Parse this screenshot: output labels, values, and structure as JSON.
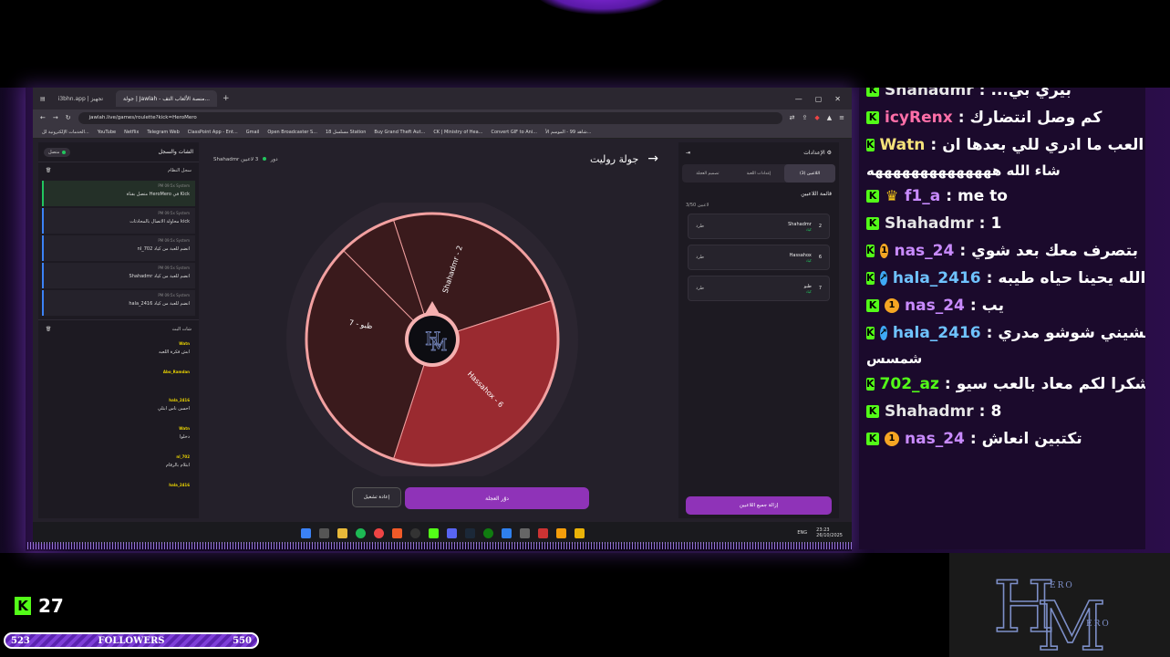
{
  "browser": {
    "tabs": [
      {
        "label": "i3bhn.app | تجهيز"
      },
      {
        "label": "جولة | Jawlah - منصة الألعاب التف..."
      }
    ],
    "new_tab": "+",
    "url": "jawlah.live/games/roulette?kick=HeroMero",
    "bookmarks": [
      "الخدمات الإلكترونية لل...",
      "YouTube",
      "Netflix",
      "Telegram Web",
      "ClassPoint App - Ent...",
      "Gmail",
      "Open Broadcaster S...",
      "مسلسل 18 Station",
      "Buy Grand Theft Aut...",
      "CK | Ministry of Hea...",
      "Convert GIF to Ani...",
      "شاهد 99 - الموسم الأ..."
    ]
  },
  "left_panel": {
    "title": "الشات والسجل",
    "connection_label": "متصل",
    "system_log_label": "سجل النظام",
    "system_items": [
      {
        "meta": "PM 09:5x System",
        "text": "متصل بقناة HeroMero في Kick"
      },
      {
        "meta": "PM 09:5x System",
        "text": "محاولة الاتصال بالمحادثات kick"
      },
      {
        "meta": "PM 09:5x System",
        "text": "nl_702 انضم للعبة من كياد"
      },
      {
        "meta": "PM 09:5x System",
        "text": "Shahadmr انضم للعبة من كياد"
      },
      {
        "meta": "PM 09:5x System",
        "text": "hala_2416 انضم للعبة من كياد"
      }
    ],
    "chat_label": "شات البث",
    "chat_items": [
      {
        "user": "Watn",
        "text": "ابش فكرة اللعبه"
      },
      {
        "user": "Abo_Ramdan",
        "text": ""
      },
      {
        "user": "hala_2416",
        "text": "احسن ناس ابتلي"
      },
      {
        "user": "Watn",
        "text": "دخلوا"
      },
      {
        "user": "nl_702",
        "text": "ابتلام بالرقام"
      },
      {
        "user": "hala_2416",
        "text": ""
      }
    ]
  },
  "center": {
    "host_label": "Shahadmr",
    "host_role": "دور",
    "players_online": "3 لاعبين",
    "title": "جولة روليت",
    "wheel_segments": [
      "Shahadmr - 2",
      "Hassahox - 6",
      "ظبو - 7"
    ],
    "spin_button": "دوّر العجلة",
    "reset_button": "إعادة تشغيل"
  },
  "right_panel": {
    "title": "الإعدادات",
    "tabs": [
      "اللاعبين (3)",
      "إعدادات اللعبة",
      "تصميم العجلة"
    ],
    "list_title": "قائمة اللاعبين",
    "count": "3/50 لاعبين",
    "players": [
      {
        "name": "Shahadmr",
        "role": "كياد",
        "number": "2",
        "kick": "طرد"
      },
      {
        "name": "Hassahox",
        "role": "كياد",
        "number": "6",
        "kick": "طرد"
      },
      {
        "name": "ظبو",
        "role": "كياد",
        "number": "7",
        "kick": "طرد"
      }
    ],
    "remove_all": "إزالة جميع اللاعبين"
  },
  "taskbar": {
    "lang": "ENG",
    "time": "23:23",
    "date": "26/10/2025"
  },
  "stream_chat": {
    "lines": [
      {
        "user": "Shahadmr",
        "msg": "...بيري بي",
        "user_color": "#e6e6e6",
        "badge": ""
      },
      {
        "user": "icyRenx",
        "msg": "كم وصل انتضارك",
        "user_color": "#ff6fa8",
        "badge": ""
      },
      {
        "user": "Watn",
        "msg": "اول مره العب ما ادري للي بعدها ان",
        "user_color": "#f5e27a",
        "badge": ""
      },
      {
        "user": "f1_a",
        "msg": "me to",
        "user_color": "#c98bff",
        "badge": "crown"
      },
      {
        "user": "Shahadmr",
        "msg": "1",
        "user_color": "#e6e6e6",
        "badge": ""
      },
      {
        "user": "nas_24",
        "msg": "بتصرف معك بعد شوي",
        "user_color": "#c98bff",
        "badge": "one"
      },
      {
        "user": "hala_2416",
        "msg": "الله يحينا حياه طيبه",
        "user_color": "#6fc3ff",
        "badge": "arrow"
      },
      {
        "user": "nas_24",
        "msg": "يب",
        "user_color": "#c98bff",
        "badge": "one"
      },
      {
        "user": "hala_2416",
        "msg": "انعشيني شوشو مدري",
        "user_color": "#6fc3ff",
        "badge": "arrow"
      },
      {
        "user": "702_az",
        "msg": "شكرا لكم معاد بالعب سيو",
        "user_color": "#53fc18",
        "badge": ""
      },
      {
        "user": "Shahadmr",
        "msg": "8",
        "user_color": "#e6e6e6",
        "badge": ""
      },
      {
        "user": "nas_24",
        "msg": "تكتبين انعاش",
        "user_color": "#c98bff",
        "badge": "one"
      }
    ],
    "wrap_watn": "شاء الله ههههههههههههههه",
    "wrap_hala": "شمسس"
  },
  "overlay": {
    "kick_count": "27",
    "followers_label": "FOLLOWERS",
    "followers_current": "523",
    "followers_goal": "550",
    "logo_text_top": "ERO",
    "logo_text_bottom": "ERO"
  },
  "colors": {
    "kick_green": "#53fc18",
    "accent_purple": "#8f33b8",
    "wheel_dark": "#3a1a1c",
    "wheel_red": "#9a2a30",
    "wheel_rim": "#f2a0a0"
  }
}
